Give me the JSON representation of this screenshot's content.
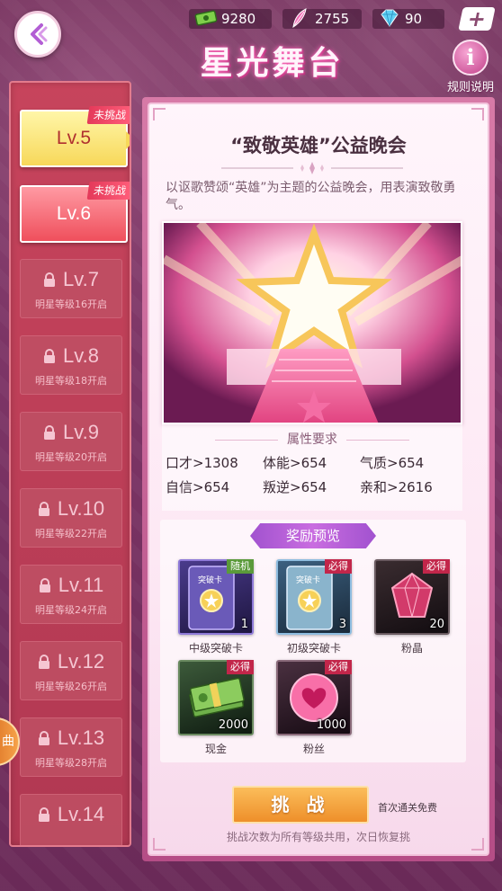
{
  "header": {
    "title": "星光舞台",
    "rules_label": "规则说明",
    "rules_icon": "info-icon",
    "currencies": [
      {
        "name": "cash",
        "icon": "cash-icon",
        "value": "9280"
      },
      {
        "name": "feather",
        "icon": "feather-icon",
        "value": "2755"
      },
      {
        "name": "diamond",
        "icon": "diamond-icon",
        "value": "90"
      }
    ]
  },
  "levels": [
    {
      "label": "Lv.5",
      "ribbon": "未挑战",
      "state": "selected"
    },
    {
      "label": "Lv.6",
      "ribbon": "未挑战",
      "state": "unlocked"
    },
    {
      "label": "Lv.7",
      "requirement": "明星等级16开启",
      "state": "locked"
    },
    {
      "label": "Lv.8",
      "requirement": "明星等级18开启",
      "state": "locked"
    },
    {
      "label": "Lv.9",
      "requirement": "明星等级20开启",
      "state": "locked"
    },
    {
      "label": "Lv.10",
      "requirement": "明星等级22开启",
      "state": "locked"
    },
    {
      "label": "Lv.11",
      "requirement": "明星等级24开启",
      "state": "locked"
    },
    {
      "label": "Lv.12",
      "requirement": "明星等级26开启",
      "state": "locked"
    },
    {
      "label": "Lv.13",
      "requirement": "明星等级28开启",
      "state": "locked"
    },
    {
      "label": "Lv.14",
      "state": "locked"
    }
  ],
  "side_coin_label": "曲",
  "stage": {
    "title": "“致敬英雄”公益晚会",
    "description": "以讴歌赞颂“英雄”为主题的公益晚会，用表演致敬勇气。",
    "attributes_heading": "属性要求",
    "attributes": [
      "口才>1308",
      "体能>654",
      "气质>654",
      "自信>654",
      "叛逆>654",
      "亲和>2616"
    ]
  },
  "rewards": {
    "heading": "奖励预览",
    "items": [
      {
        "name": "中级突破卡",
        "qty": "1",
        "tag": "随机",
        "card_text": "突破卡"
      },
      {
        "name": "初级突破卡",
        "qty": "3",
        "tag": "必得",
        "card_text": "突破卡"
      },
      {
        "name": "粉晶",
        "qty": "20",
        "tag": "必得"
      },
      {
        "name": "现金",
        "qty": "2000",
        "tag": "必得"
      },
      {
        "name": "粉丝",
        "qty": "1000",
        "tag": "必得"
      }
    ]
  },
  "challenge": {
    "button_label": "挑 战",
    "free_note": "首次通关免费",
    "bottom_note": "挑战次数为所有等级共用，次日恢复挑"
  },
  "colors": {
    "accent_pink": "#c2408a",
    "gold": "#f7d85a",
    "challenge_orange": "#ee8f2a",
    "reward_purple": "#a152cf"
  }
}
